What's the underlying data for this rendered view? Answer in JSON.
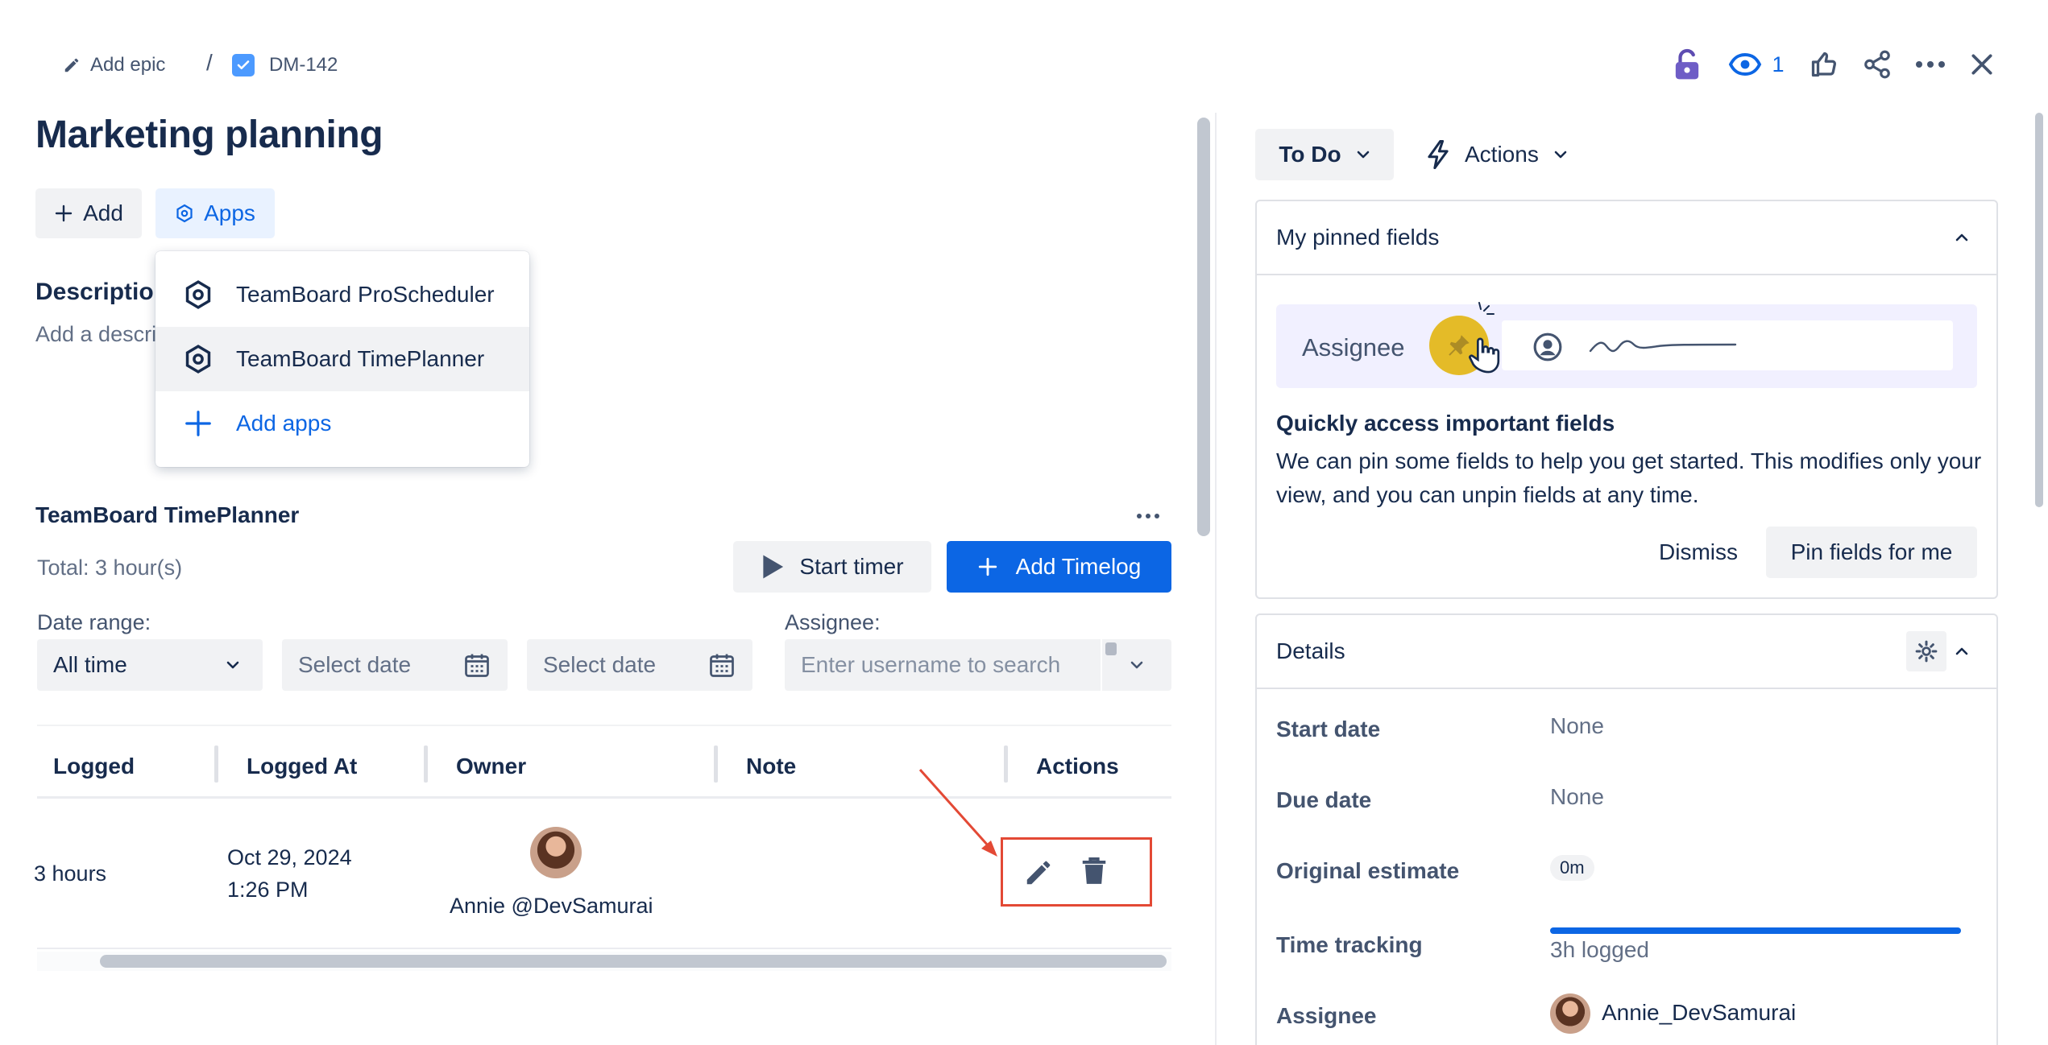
{
  "breadcrumb": {
    "epic_label": "Add epic",
    "separator": "/",
    "issue_key": "DM-142"
  },
  "header": {
    "watch_count": "1"
  },
  "issue": {
    "title": "Marketing planning",
    "add_button": "Add",
    "apps_button": "Apps",
    "description_label": "Descriptio",
    "description_placeholder": "Add a descri"
  },
  "apps_menu": {
    "items": [
      {
        "label": "TeamBoard ProScheduler"
      },
      {
        "label": "TeamBoard TimePlanner"
      }
    ],
    "add_apps": "Add apps"
  },
  "timeplanner": {
    "title": "TeamBoard TimePlanner",
    "total": "Total: 3 hour(s)",
    "start_timer": "Start timer",
    "add_timelog": "Add Timelog",
    "date_range_label": "Date range:",
    "date_range_value": "All time",
    "date_placeholder_1": "Select date",
    "date_placeholder_2": "Select date",
    "assignee_label": "Assignee:",
    "assignee_placeholder": "Enter username to search",
    "table": {
      "columns": [
        "Logged",
        "Logged At",
        "Owner",
        "Note",
        "Actions"
      ],
      "rows": [
        {
          "logged": "3 hours",
          "logged_at_date": "Oct 29, 2024",
          "logged_at_time": "1:26 PM",
          "owner": "Annie @DevSamurai",
          "note": ""
        }
      ]
    }
  },
  "status": {
    "current": "To Do",
    "actions": "Actions"
  },
  "pinned": {
    "title": "My pinned fields",
    "demo_label": "Assignee",
    "headline": "Quickly access important fields",
    "body": "We can pin some fields to help you get started. This modifies only your view, and you can unpin fields at any time.",
    "dismiss": "Dismiss",
    "pin_button": "Pin fields for me"
  },
  "details": {
    "title": "Details",
    "start_date_label": "Start date",
    "start_date_value": "None",
    "due_date_label": "Due date",
    "due_date_value": "None",
    "estimate_label": "Original estimate",
    "estimate_value": "0m",
    "time_tracking_label": "Time tracking",
    "time_tracking_value": "3h logged",
    "time_tracking_progress": 1.0,
    "assignee_label": "Assignee",
    "assignee_value": "Annie_DevSamurai"
  },
  "colors": {
    "primary": "#0c66e4",
    "highlight": "#e34935",
    "pin_yellow": "#e2b203"
  },
  "icons": [
    "pencil-icon",
    "checkbox-icon",
    "unlock-icon",
    "eye-icon",
    "thumbs-up-icon",
    "share-icon",
    "more-icon",
    "close-icon",
    "plus-icon",
    "app-hexagon-icon",
    "play-icon",
    "calendar-icon",
    "chevron-down-icon",
    "lightning-icon",
    "pin-icon",
    "user-circle-icon",
    "gear-icon",
    "trash-icon"
  ]
}
